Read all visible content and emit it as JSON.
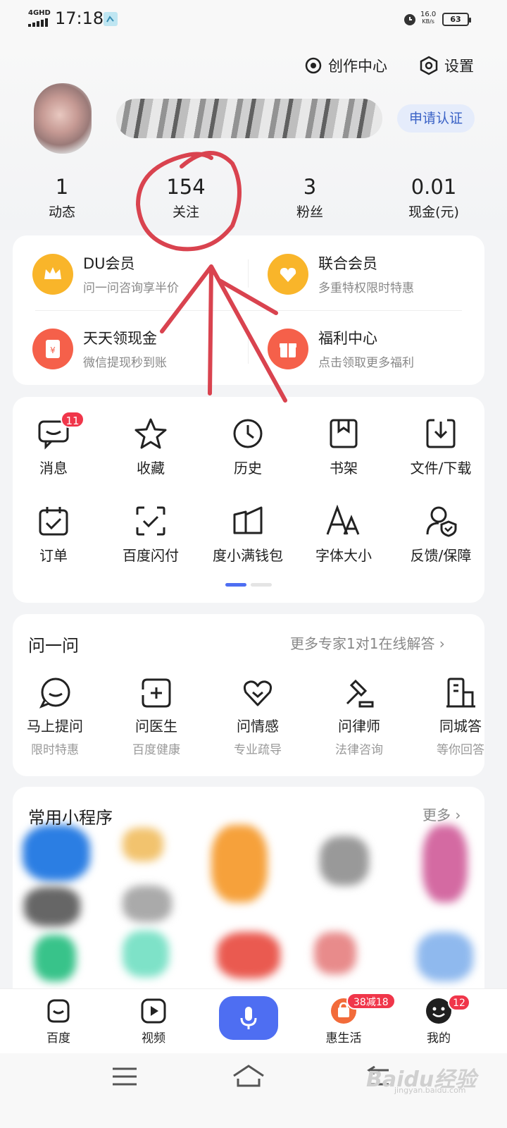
{
  "status_bar": {
    "network": "4GHD",
    "time": "17:18",
    "speed_value": "16.0",
    "speed_unit": "KB/s",
    "battery": "63"
  },
  "header": {
    "creator_center": "创作中心",
    "settings": "设置",
    "certify_button": "申请认证"
  },
  "stats": [
    {
      "value": "1",
      "label": "动态"
    },
    {
      "value": "154",
      "label": "关注"
    },
    {
      "value": "3",
      "label": "粉丝"
    },
    {
      "value": "0.01",
      "label": "现金(元)"
    }
  ],
  "vip": [
    {
      "title": "DU会员",
      "subtitle": "问一问咨询享半价",
      "icon": "crown-icon",
      "color": "#f9b52a"
    },
    {
      "title": "联合会员",
      "subtitle": "多重特权限时特惠",
      "icon": "heart-badge-icon",
      "color": "#f9b52a"
    },
    {
      "title": "天天领现金",
      "subtitle": "微信提现秒到账",
      "icon": "red-envelope-icon",
      "color": "#f5604a"
    },
    {
      "title": "福利中心",
      "subtitle": "点击领取更多福利",
      "icon": "gift-icon",
      "color": "#f5604a"
    }
  ],
  "tools": [
    {
      "label": "消息",
      "icon": "message-icon"
    },
    {
      "label": "收藏",
      "icon": "star-icon"
    },
    {
      "label": "历史",
      "icon": "clock-icon"
    },
    {
      "label": "书架",
      "icon": "bookmark-icon"
    },
    {
      "label": "文件/下载",
      "icon": "download-icon"
    },
    {
      "label": "订单",
      "icon": "order-icon"
    },
    {
      "label": "百度闪付",
      "icon": "scan-pay-icon"
    },
    {
      "label": "度小满钱包",
      "icon": "wallet-icon"
    },
    {
      "label": "字体大小",
      "icon": "font-size-icon"
    },
    {
      "label": "反馈/保障",
      "icon": "feedback-shield-icon"
    }
  ],
  "message_badge": "11",
  "ask": {
    "title": "问一问",
    "more": "更多专家1对1在线解答",
    "items": [
      {
        "label": "马上提问",
        "sub": "限时特惠",
        "icon": "chat-smile-icon"
      },
      {
        "label": "问医生",
        "sub": "百度健康",
        "icon": "medical-plus-icon"
      },
      {
        "label": "问情感",
        "sub": "专业疏导",
        "icon": "heart-icon"
      },
      {
        "label": "问律师",
        "sub": "法律咨询",
        "icon": "gavel-icon"
      },
      {
        "label": "同城答",
        "sub": "等你回答",
        "icon": "building-icon"
      }
    ]
  },
  "mini_programs": {
    "title": "常用小程序",
    "more": "更多"
  },
  "bottom_nav": [
    {
      "label": "百度",
      "icon": "baidu-home-icon"
    },
    {
      "label": "视频",
      "icon": "video-play-icon"
    },
    {
      "label": "",
      "icon": "microphone-icon"
    },
    {
      "label": "惠生活",
      "icon": "shopping-bag-icon"
    },
    {
      "label": "我的",
      "icon": "profile-face-icon"
    }
  ],
  "badges": {
    "hui_shenghuo": "38减18",
    "mine": "12"
  },
  "watermark": {
    "main": "Baidu经验",
    "sub": "jingyan.baidu.com"
  },
  "colors": {
    "accent": "#4e6ef2",
    "badge": "#f0364a",
    "annotation": "#d9434f"
  }
}
